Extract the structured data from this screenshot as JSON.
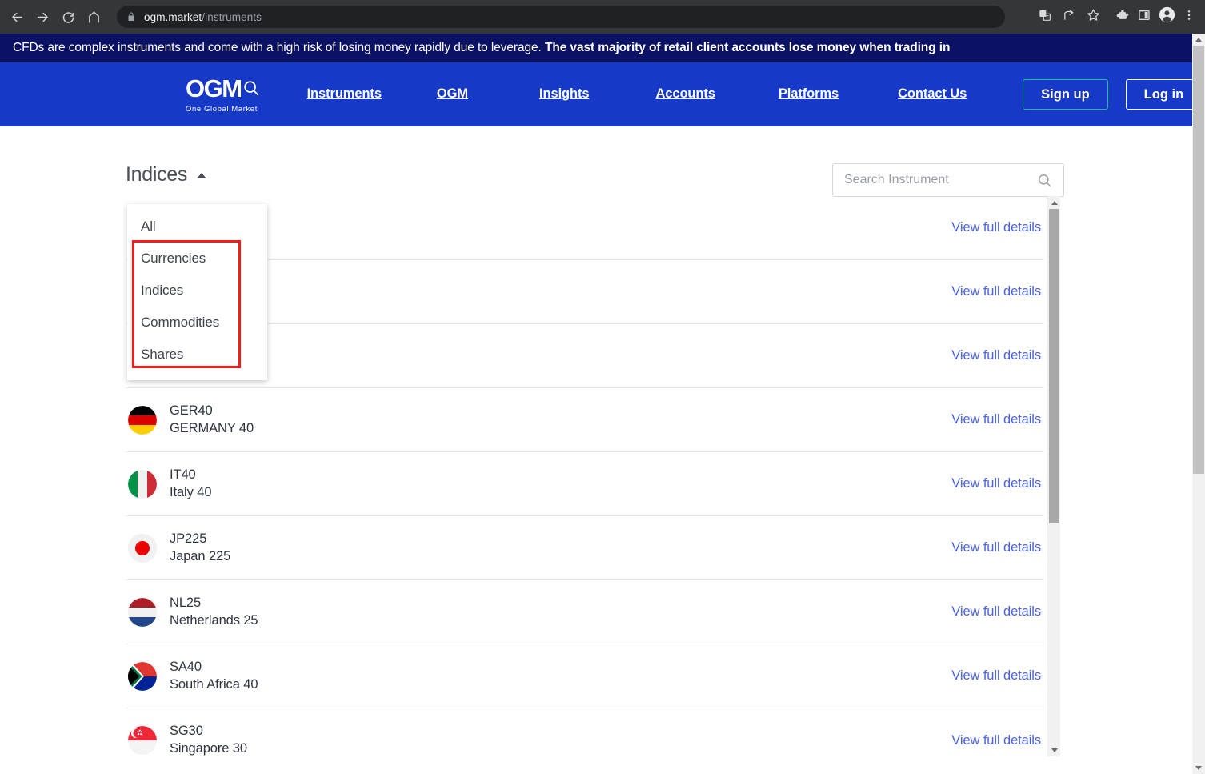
{
  "browser": {
    "url_domain": "ogm.market",
    "url_path": "/instruments",
    "back_icon": "back-arrow-icon",
    "forward_icon": "forward-arrow-icon",
    "reload_icon": "reload-icon",
    "home_icon": "home-icon",
    "lock_icon": "lock-icon",
    "translate_icon": "translate-icon",
    "share_icon": "share-icon",
    "bookmark_icon": "star-icon",
    "extensions_icon": "puzzle-piece-icon",
    "sidepanel_icon": "side-panel-icon",
    "profile_icon": "profile-avatar-icon",
    "menu_icon": "three-dot-menu-icon"
  },
  "banner": {
    "text_regular": "CFDs are complex instruments and come with a high risk of losing money rapidly due to leverage. ",
    "text_bold": "The vast majority of retail client accounts lose money when trading in",
    "background": "#0b1263"
  },
  "header": {
    "logo_text": "OGM",
    "logo_tagline": "One Global Market",
    "background": "#1739c8",
    "nav": [
      {
        "label": "Instruments",
        "class": "instruments"
      },
      {
        "label": "OGM",
        "class": "ogm"
      },
      {
        "label": "Insights",
        "class": "insights"
      },
      {
        "label": "Accounts",
        "class": "accounts"
      },
      {
        "label": "Platforms",
        "class": "platforms"
      },
      {
        "label": "Contact Us",
        "class": "contact"
      }
    ],
    "signup_label": "Sign up",
    "signup_border": "#1fc08a",
    "login_label": "Log in",
    "login_border": "#ffffff"
  },
  "toolbar": {
    "filter_label": "Indices",
    "search_placeholder": "Search Instrument",
    "search_value": ""
  },
  "dropdown": {
    "open": true,
    "items": [
      {
        "label": "All"
      },
      {
        "label": "Currencies"
      },
      {
        "label": "Indices"
      },
      {
        "label": "Commodities"
      },
      {
        "label": "Shares"
      }
    ],
    "highlight_color": "#ff1a1a"
  },
  "list": {
    "details_link_label": "View full details",
    "link_color": "#4a63e0",
    "rows": [
      {
        "code": "",
        "name": "",
        "flag": "hidden",
        "hidden_behind_dropdown": true
      },
      {
        "code": "",
        "name": "",
        "flag": "hidden",
        "hidden_behind_dropdown": true
      },
      {
        "code": "",
        "name": "",
        "flag": "hidden",
        "hidden_behind_dropdown": true
      },
      {
        "code": "GER40",
        "name": "GERMANY 40",
        "flag": "germany-flag-icon"
      },
      {
        "code": "IT40",
        "name": "Italy 40",
        "flag": "italy-flag-icon"
      },
      {
        "code": "JP225",
        "name": "Japan 225",
        "flag": "japan-flag-icon"
      },
      {
        "code": "NL25",
        "name": "Netherlands 25",
        "flag": "netherlands-flag-icon"
      },
      {
        "code": "SA40",
        "name": "South Africa 40",
        "flag": "south-africa-flag-icon"
      },
      {
        "code": "SG30",
        "name": "Singapore 30",
        "flag": "singapore-flag-icon"
      }
    ]
  }
}
